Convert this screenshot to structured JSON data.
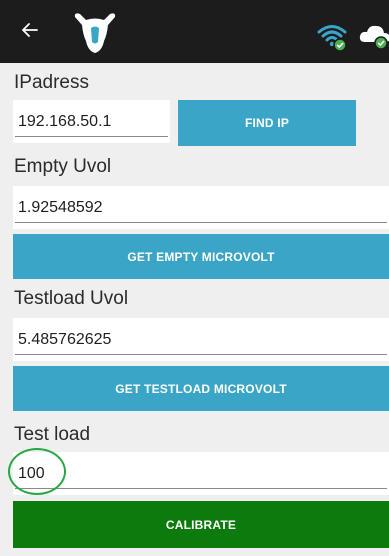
{
  "header": {
    "back_icon": "arrow-left-icon",
    "logo_icon": "cow-head-icon",
    "wifi_icon": "wifi-connected-icon",
    "cloud_icon": "cloud-connected-icon",
    "bg_color": "#1c1c1c",
    "status_color": "#4caf50"
  },
  "ip": {
    "label": "IPadress",
    "value": "192.168.50.1",
    "button_label": "FIND IP"
  },
  "empty": {
    "label": "Empty Uvol",
    "value": "1.92548592",
    "button_label": "GET EMPTY MICROVOLT"
  },
  "testload": {
    "label": "Testload Uvol",
    "value": "5.485762625",
    "button_label": "GET TESTLOAD  MICROVOLT"
  },
  "test_load": {
    "label": "Test load",
    "value": "100"
  },
  "calibrate": {
    "button_label": "CALIBRATE"
  },
  "colors": {
    "accent_blue": "#3aa5c6",
    "calibrate_green": "#0d7a0d",
    "highlight_green": "#27a844"
  }
}
